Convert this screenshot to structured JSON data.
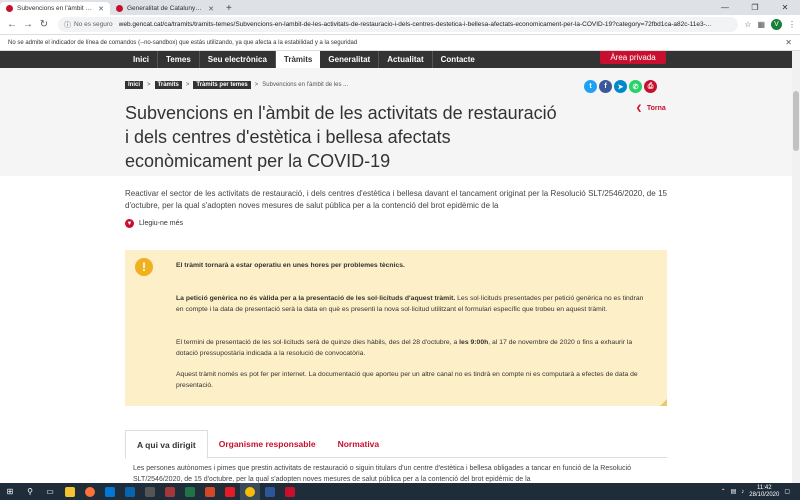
{
  "browser": {
    "tabs": [
      {
        "title": "Subvencions en l'àmbit de les acti"
      },
      {
        "title": "Generalitat de Catalunya - Oficin"
      }
    ],
    "new_tab": "+",
    "security": "No es seguro",
    "url": "web.gencat.cat/ca/tramits/tramits-temes/Subvencions-en-lambit-de-les-activitats-de-restauracio-i-dels-centres-destetica-i-bellesa-afectats-economicament-per-la-COVID-19?category=72fbd1ca-a82c-11e3-...",
    "avatar_letter": "V",
    "infobar_text": "No se admite el indicador de línea de comandos (--no-sandbox) que estás utilizando, ya que afecta a la estabilidad y a la seguridad"
  },
  "site_nav": {
    "items": [
      {
        "label": "Inici"
      },
      {
        "label": "Temes"
      },
      {
        "label": "Seu electrònica"
      },
      {
        "label": "Tràmits"
      },
      {
        "label": "Generalitat"
      },
      {
        "label": "Actualitat"
      },
      {
        "label": "Contacte"
      }
    ],
    "active_index": 3,
    "private_area": "Àrea privada"
  },
  "breadcrumb": {
    "items": [
      "Inici",
      "Tràmits",
      "Tràmits per temes"
    ],
    "current": "Subvencions en l'àmbit de les ..."
  },
  "back_link": "Torna",
  "title": "Subvencions en l'àmbit de les activitats de restauració i dels centres d'estètica i bellesa afectats econòmicament per la COVID-19",
  "intro": "Reactivar el sector de les activitats de restauració, i dels centres d'estètica i bellesa davant el tancament originat per la Resolució SLT/2546/2020, de 15 d'octubre, per la qual s'adopten noves mesures de salut pública per a la contenció del brot epidèmic de la",
  "read_more": "Llegiu-ne més",
  "notice": {
    "line1": "El tràmit tornarà a estar operatiu en unes hores per problemes tècnics.",
    "p2_bold": "La petició genèrica no és vàlida per a la presentació de les sol·licituds d'aquest tràmit.",
    "p2_rest": " Les sol·licituds presentades per petició genèrica no es tindran en compte i la data de presentació serà la data en què es presenti la nova sol·licitud utilitzant el formulari específic que trobeu en aquest tràmit.",
    "p3_a": "El termini de presentació de les sol·licituds serà de quinze dies hàbils, des del 28 d'octubre, a ",
    "p3_bold": "les 9:00h",
    "p3_b": ", al 17 de novembre de 2020 o fins a exhaurir la dotació pressupostària indicada a la resolució de convocatòria.",
    "p4": "Aquest tràmit només es pot fer per internet. La documentació que aporteu per un altre canal no es tindrà en compte ni es computarà a efectes de data de presentació."
  },
  "content_tabs": [
    {
      "label": "A qui va dirigit"
    },
    {
      "label": "Organisme responsable"
    },
    {
      "label": "Normativa"
    }
  ],
  "tab_content": "Les persones autònomes i pimes que prestin activitats de restauració o siguin titulars d'un centre d'estètica i bellesa obligades a tancar en funció de la Resolució SLT/2546/2020, de 15 d'octubre, per la qual s'adopten noves mesures de salut pública per a la contenció del brot epidèmic de la",
  "taskbar": {
    "time": "11:42",
    "date": "28/10/2020"
  },
  "colors": {
    "brand_red": "#c8102e",
    "nav_dark": "#333333",
    "notice_bg": "#fdefc7"
  }
}
